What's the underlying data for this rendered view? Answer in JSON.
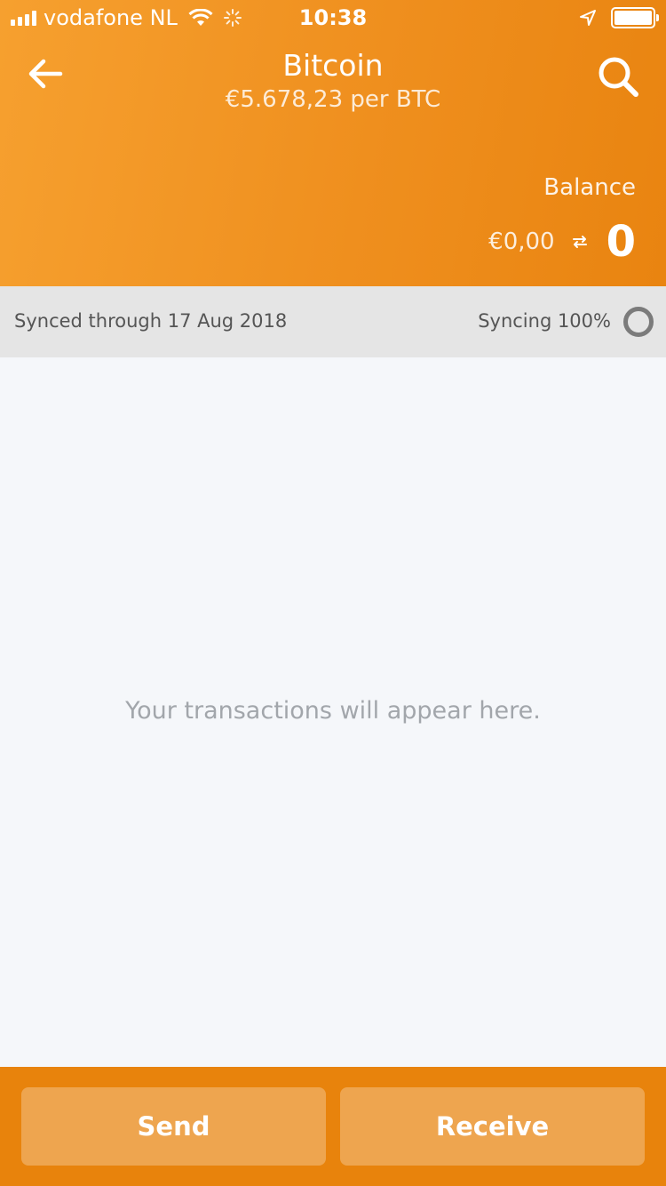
{
  "status_bar": {
    "carrier": "vodafone NL",
    "time": "10:38",
    "battery_level": 1.0,
    "icons": [
      "signal-icon",
      "wifi-icon",
      "activity-spinner-icon",
      "location-arrow-icon",
      "battery-icon"
    ]
  },
  "header": {
    "title": "Bitcoin",
    "subtitle": "€5.678,23 per BTC",
    "balance_label": "Balance",
    "fiat_balance": "€0,00",
    "crypto_balance": "0",
    "colors": {
      "gradient_start": "#f6a02f",
      "gradient_end": "#e98410"
    }
  },
  "sync": {
    "synced_text": "Synced through 17 Aug 2018",
    "status_text": "Syncing 100%",
    "progress": 1.0
  },
  "main": {
    "empty_message": "Your transactions will appear here."
  },
  "footer": {
    "send_label": "Send",
    "receive_label": "Receive",
    "bg_color": "#e8830c"
  }
}
